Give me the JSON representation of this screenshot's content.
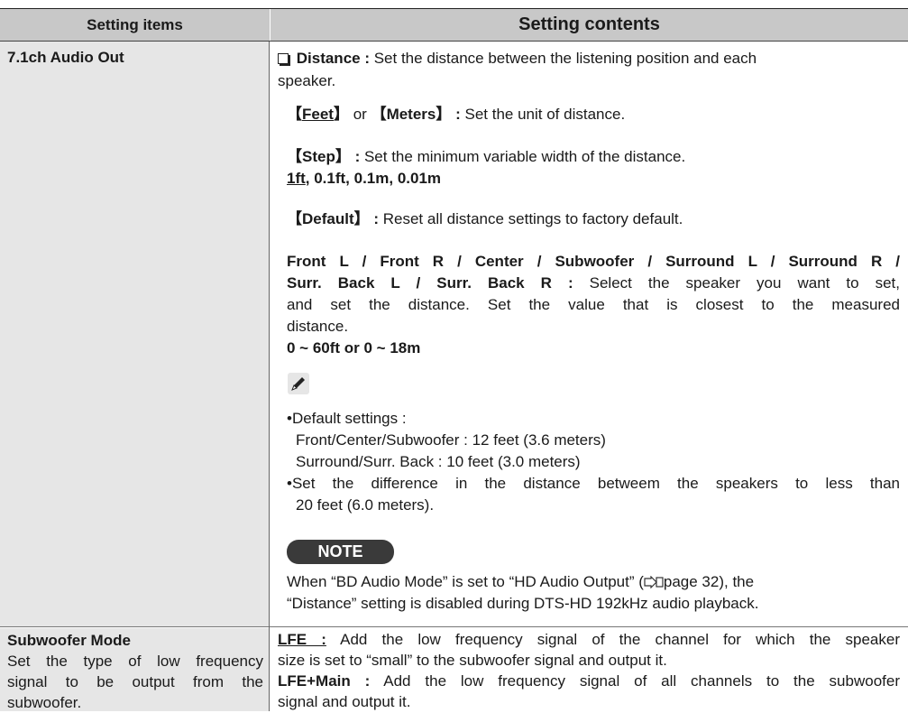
{
  "header": {
    "col1": "Setting items",
    "col2": "Setting contents"
  },
  "row1": {
    "item": "7.1ch Audio Out",
    "distance_label": "Distance :",
    "distance_desc_1": "Set the distance between the listening position and each",
    "distance_desc_2": "speaker.",
    "feet": "Feet",
    "or": "or",
    "meters": "Meters",
    "unit_desc": "Set the unit of distance.",
    "step": "Step",
    "step_desc": "Set the minimum variable width of the distance.",
    "step_default": "1ft",
    "step_values": ", 0.1ft, 0.1m, 0.01m",
    "default_label": "Default",
    "default_desc": "Reset all distance settings to factory default.",
    "speakers_line1": "Front L / Front R / Center / Subwoofer / Surround L / Surround R /",
    "speakers_line2_bold": "Surr. Back L / Surr. Back R :",
    "speakers_line2_rest": "Select the speaker you want to set,",
    "speakers_line3": "and set the distance. Set the value that is closest to the measured",
    "speakers_line4": "distance.",
    "range": "0 ~ 60ft or 0 ~ 18m",
    "bullet1_title": "Default settings :",
    "bullet1_line2": "Front/Center/Subwoofer : 12 feet (3.6 meters)",
    "bullet1_line3": "Surround/Surr. Back : 10 feet (3.0 meters)",
    "bullet2_line1": "Set the difference in the distance betweem the speakers to less than",
    "bullet2_line2": "20 feet (6.0 meters).",
    "note_badge": "NOTE",
    "note_line1_a": "When “BD Audio Mode” is set to “HD Audio Output” (",
    "note_line1_b": "page 32), the",
    "note_line2": "“Distance” setting is disabled during DTS-HD 192kHz audio playback."
  },
  "row2": {
    "item": "Subwoofer Mode",
    "item_desc_1": "Set the type of low frequency",
    "item_desc_2": "signal to be output from the",
    "item_desc_3": "subwoofer.",
    "lfe_label": "LFE :",
    "lfe_desc_1": "Add the low frequency signal of the channel for which the speaker",
    "lfe_desc_2": "size is set to “small” to the subwoofer signal and output it.",
    "lfemain_label": "LFE+Main :",
    "lfemain_desc_1": "Add the low frequency signal of all channels to the subwoofer",
    "lfemain_desc_2": "signal and output it."
  },
  "icons": [
    "checkbox-icon",
    "pencil-icon",
    "page-reference-icon"
  ]
}
